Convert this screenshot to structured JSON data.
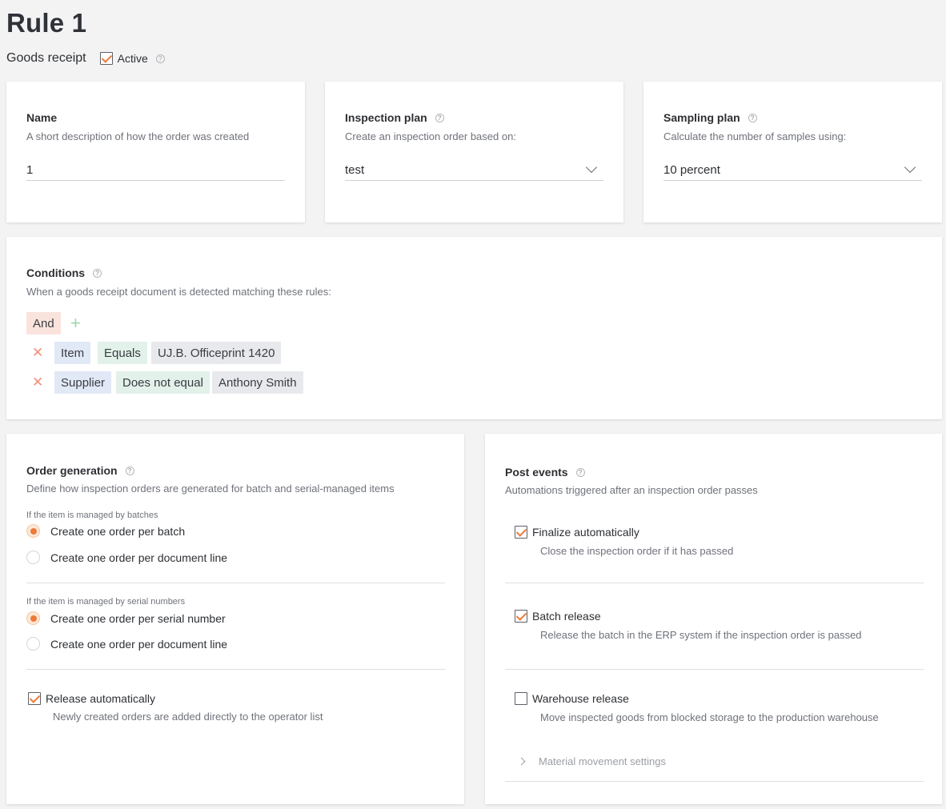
{
  "page": {
    "title": "Rule 1",
    "type": "Goods receipt",
    "active_label": "Active",
    "active_checked": true
  },
  "name_card": {
    "title": "Name",
    "description": "A short description of how the order was created",
    "value": "1"
  },
  "inspection_card": {
    "title": "Inspection plan",
    "description": "Create an inspection order based on:",
    "value": "test"
  },
  "sampling_card": {
    "title": "Sampling plan",
    "description": "Calculate the number of samples using:",
    "value": "10 percent"
  },
  "conditions": {
    "title": "Conditions",
    "description": "When a goods receipt document is detected matching these rules:",
    "logic": "And",
    "rules": [
      {
        "field": "Item",
        "operator": "Equals",
        "value": "UJ.B. Officeprint 1420"
      },
      {
        "field": "Supplier",
        "operator": "Does not equal",
        "value": "Anthony Smith"
      }
    ]
  },
  "order_generation": {
    "title": "Order generation",
    "description": "Define how inspection orders are generated for batch and serial-managed items",
    "batch_group": {
      "label": "If the item is managed by batches",
      "options": [
        "Create one order per batch",
        "Create one order per document line"
      ],
      "selected": "Create one order per batch"
    },
    "serial_group": {
      "label": "If the item is managed by serial numbers",
      "options": [
        "Create one order per serial number",
        "Create one order per document line"
      ],
      "selected": "Create one order per serial number"
    },
    "release": {
      "label": "Release automatically",
      "description": "Newly created orders are added directly to the operator list",
      "checked": true
    }
  },
  "post_events": {
    "title": "Post events",
    "description": "Automations triggered after an inspection order passes",
    "items": [
      {
        "label": "Finalize automatically",
        "description": "Close the inspection order if it has passed",
        "checked": true
      },
      {
        "label": "Batch release",
        "description": "Release the batch in the ERP system if the inspection order is passed",
        "checked": true
      },
      {
        "label": "Warehouse release",
        "description": "Move inspected goods from blocked storage to the production warehouse",
        "checked": false
      }
    ],
    "material_settings_label": "Material movement settings"
  },
  "colors": {
    "accent": "#ee7a3a",
    "background": "#f3f3f4",
    "card": "#ffffff"
  }
}
